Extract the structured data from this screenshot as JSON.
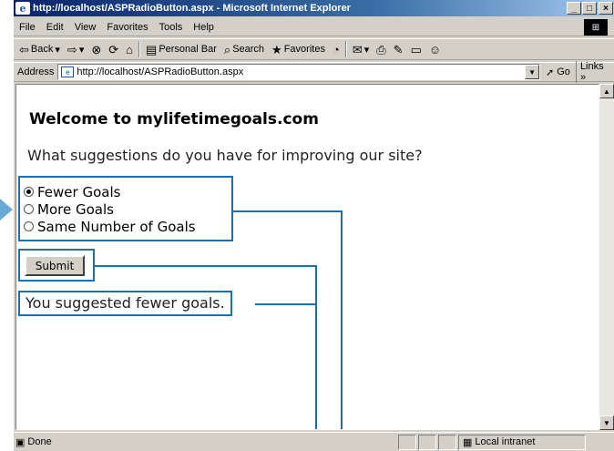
{
  "window": {
    "title": "http://localhost/ASPRadioButton.aspx - Microsoft Internet Explorer",
    "min": "_",
    "max": "□",
    "close": "×"
  },
  "menu": [
    "File",
    "Edit",
    "View",
    "Favorites",
    "Tools",
    "Help"
  ],
  "toolbar": {
    "back": "Back",
    "personal_bar": "Personal Bar",
    "search": "Search",
    "favorites": "Favorites"
  },
  "address": {
    "label": "Address",
    "url": "http://localhost/ASPRadioButton.aspx",
    "go": "Go",
    "links": "Links »"
  },
  "page": {
    "heading": "Welcome to mylifetimegoals.com",
    "question": "What suggestions do you have for improving our site?",
    "options": [
      {
        "label": "Fewer Goals",
        "checked": true
      },
      {
        "label": "More Goals",
        "checked": false
      },
      {
        "label": "Same Number of Goals",
        "checked": false
      }
    ],
    "submit": "Submit",
    "result": "You suggested fewer goals."
  },
  "status": {
    "text": "Done",
    "zone": "Local intranet"
  },
  "colors": {
    "callout": "#1e6fae",
    "arrow": "#6aa8d8"
  }
}
